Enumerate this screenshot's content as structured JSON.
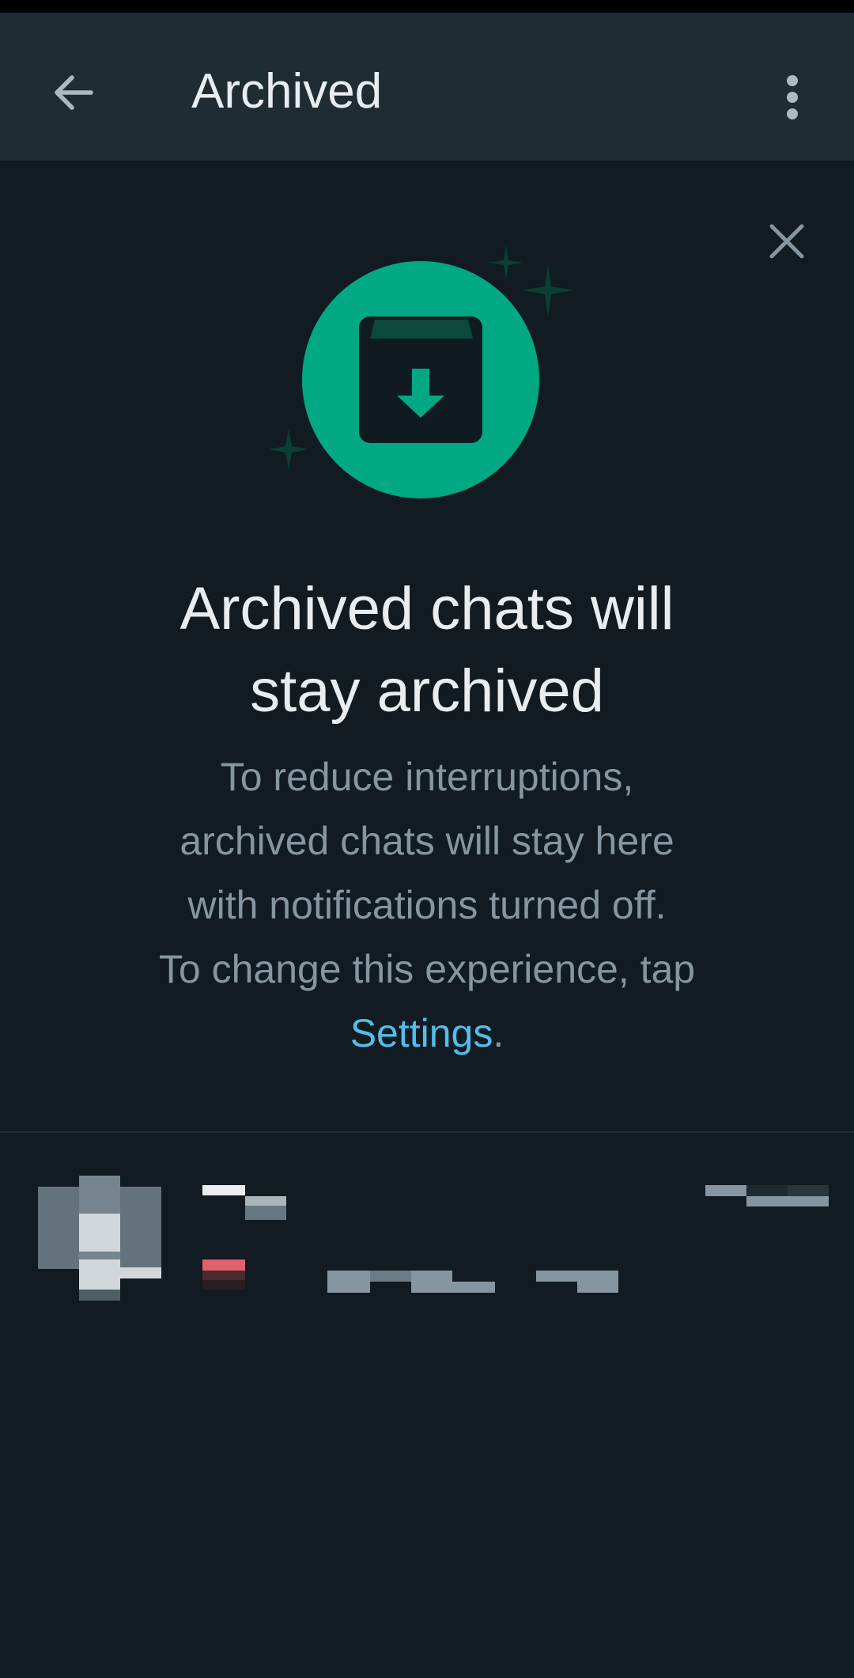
{
  "header": {
    "title": "Archived",
    "back_icon": "arrow-left-icon",
    "menu_icon": "more-vert-icon"
  },
  "banner": {
    "close_icon": "close-icon",
    "illustration_icon": "archive-box-icon",
    "headline_line1": "Archived chats will",
    "headline_line2": "stay archived",
    "body_line1": "To reduce interruptions,",
    "body_line2": "archived chats will stay here",
    "body_line3": "with notifications turned off.",
    "body_line4": "To change this experience, tap",
    "settings_link": "Settings",
    "period": "."
  },
  "colors": {
    "background": "#111b21",
    "appbar": "#1f2c34",
    "accent_green": "#00a884",
    "link_blue": "#53bdeb",
    "text_primary": "#e9edef",
    "text_secondary": "#8696a0"
  }
}
